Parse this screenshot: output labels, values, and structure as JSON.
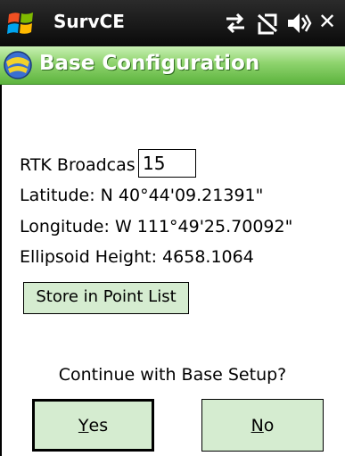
{
  "statusbar": {
    "app_title": "SurvCE",
    "icons": [
      "windows-start-icon",
      "connectivity-icon",
      "no-signal-icon",
      "volume-icon",
      "close-icon"
    ],
    "close_glyph": "✕"
  },
  "header": {
    "title": "Base Configuration",
    "icon": "survce-logo-icon"
  },
  "form": {
    "rtk_label": "RTK Broadcas",
    "rtk_value": "15",
    "latitude": "Latitude:  N 40°44'09.21391\"",
    "longitude": "Longitude:  W 111°49'25.70092\"",
    "ellipsoid_height": "Ellipsoid Height: 4658.1064",
    "store_button": "Store in Point List"
  },
  "prompt": {
    "question": "Continue with Base Setup?",
    "yes_mnemonic": "Y",
    "yes_rest": "es",
    "no_mnemonic": "N",
    "no_rest": "o"
  },
  "colors": {
    "statusbar_bg": "#111111",
    "header_green": "#6cc24a",
    "button_bg": "#d5ecd0"
  }
}
